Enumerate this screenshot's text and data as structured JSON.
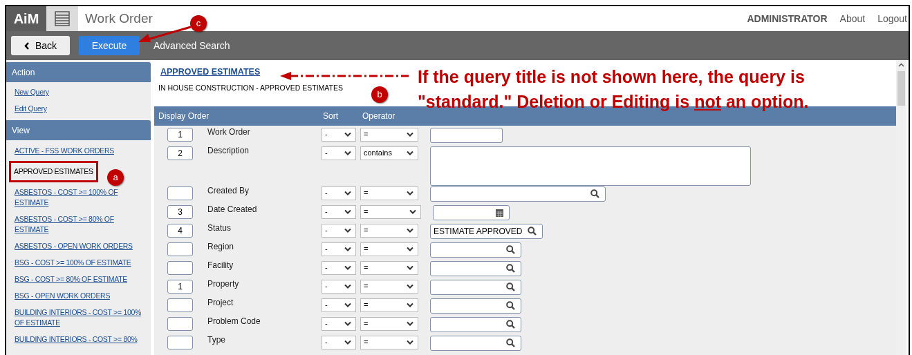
{
  "app": {
    "logo": "AiM",
    "title": "Work Order"
  },
  "user_menu": {
    "user": "ADMINISTRATOR",
    "links": [
      "About",
      "Logout"
    ]
  },
  "toolbar": {
    "back": "Back",
    "execute": "Execute",
    "advanced": "Advanced Search"
  },
  "sidebar": {
    "sections": [
      {
        "title": "Action",
        "items": [
          {
            "label": "New Query",
            "selected": false
          },
          {
            "label": "Edit Query",
            "selected": false
          }
        ]
      },
      {
        "title": "View",
        "items": [
          {
            "label": "ACTIVE - FSS WORK ORDERS",
            "selected": false
          },
          {
            "label": "APPROVED ESTIMATES",
            "selected": true
          },
          {
            "label": "ASBESTOS - COST >= 100% OF ESTIMATE",
            "selected": false
          },
          {
            "label": "ASBESTOS - COST >= 80% OF ESTIMATE",
            "selected": false
          },
          {
            "label": "ASBESTOS - OPEN WORK ORDERS",
            "selected": false
          },
          {
            "label": "BSG - COST >= 100% OF ESTIMATE",
            "selected": false
          },
          {
            "label": "BSG - COST >= 80% OF ESTIMATE",
            "selected": false
          },
          {
            "label": "BSG - OPEN WORK ORDERS",
            "selected": false
          },
          {
            "label": "BUILDING INTERIORS - COST >= 100% OF ESTIMATE",
            "selected": false
          },
          {
            "label": "BUILDING INTERIORS - COST >= 80%",
            "selected": false
          }
        ]
      }
    ]
  },
  "query": {
    "title": "APPROVED ESTIMATES",
    "subtitle": "IN HOUSE CONSTRUCTION - APPROVED ESTIMATES"
  },
  "table": {
    "columns": [
      "Display Order",
      "Sort",
      "Operator"
    ],
    "rows": [
      {
        "order": "1",
        "label": "Work Order",
        "sort": "-",
        "operator": "=",
        "kind": "text"
      },
      {
        "order": "2",
        "label": "Description",
        "sort": "-",
        "operator": "contains",
        "kind": "textarea"
      },
      {
        "order": "",
        "label": "Created By",
        "sort": "-",
        "operator": "=",
        "kind": "search"
      },
      {
        "order": "3",
        "label": "Date Created",
        "sort": "-",
        "operator": "=",
        "kind": "date"
      },
      {
        "order": "4",
        "label": "Status",
        "sort": "-",
        "operator": "=",
        "kind": "lookup",
        "value": "ESTIMATE APPROVED"
      },
      {
        "order": "",
        "label": "Region",
        "sort": "-",
        "operator": "=",
        "kind": "lookup"
      },
      {
        "order": "",
        "label": "Facility",
        "sort": "-",
        "operator": "=",
        "kind": "lookup"
      },
      {
        "order": "1",
        "label": "Property",
        "sort": "-",
        "operator": "=",
        "kind": "lookup"
      },
      {
        "order": "",
        "label": "Project",
        "sort": "-",
        "operator": "=",
        "kind": "lookup"
      },
      {
        "order": "",
        "label": "Problem Code",
        "sort": "-",
        "operator": "=",
        "kind": "lookup"
      },
      {
        "order": "",
        "label": "Type",
        "sort": "-",
        "operator": "=",
        "kind": "lookup"
      }
    ]
  },
  "annotations": {
    "markers": [
      "a",
      "b",
      "c"
    ],
    "note_before": "If the query title is not shown here, the query is \"standard.\" Deletion or Editing is ",
    "note_underlined": "not",
    "note_after": " an option."
  }
}
